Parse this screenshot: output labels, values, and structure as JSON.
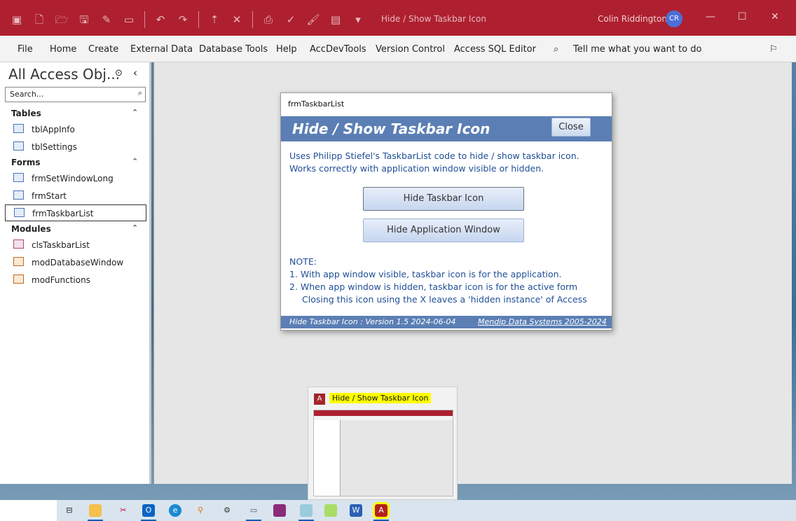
{
  "window": {
    "title": "Hide / Show Taskbar Icon",
    "user": "Colin Riddington",
    "initials": "CR",
    "accent": "#ae2030"
  },
  "menu": [
    "File",
    "Home",
    "Create",
    "External Data",
    "Database Tools",
    "Help",
    "AccDevTools",
    "Version Control",
    "Access SQL Editor"
  ],
  "tell_me": "Tell me what you want to do",
  "nav": {
    "title": "All Access Obj...",
    "search_placeholder": "Search...",
    "groups": [
      {
        "label": "Tables",
        "items": [
          "tblAppInfo",
          "tblSettings"
        ]
      },
      {
        "label": "Forms",
        "items": [
          "frmSetWindowLong",
          "frmStart",
          "frmTaskbarList"
        ]
      },
      {
        "label": "Modules",
        "items": [
          "clsTaskbarList",
          "modDatabaseWindow",
          "modFunctions"
        ]
      }
    ],
    "selected": "frmTaskbarList"
  },
  "form": {
    "caption": "frmTaskbarList",
    "heading": "Hide / Show Taskbar Icon",
    "close": "Close",
    "intro1": "Uses Philipp Stiefel's TaskbarList code to hide / show taskbar icon.",
    "intro2": "Works correctly with application window visible or hidden.",
    "btn_hide_icon": "Hide Taskbar Icon",
    "btn_hide_window": "Hide Application Window",
    "note": "NOTE:",
    "note1": "1.  With app window visible, taskbar icon is for the application.",
    "note2": "2.  When app window is hidden, taskbar icon is for the active form",
    "note3": "Closing this icon using the X leaves a 'hidden instance' of Access",
    "footer_left": "Hide Taskbar Icon :  Version 1.5     2024-06-04",
    "footer_right": "Mendip Data Systems 2005-2024",
    "band_color": "#5b7fb4"
  },
  "thumbnail": {
    "title": "Hide / Show Taskbar Icon"
  }
}
